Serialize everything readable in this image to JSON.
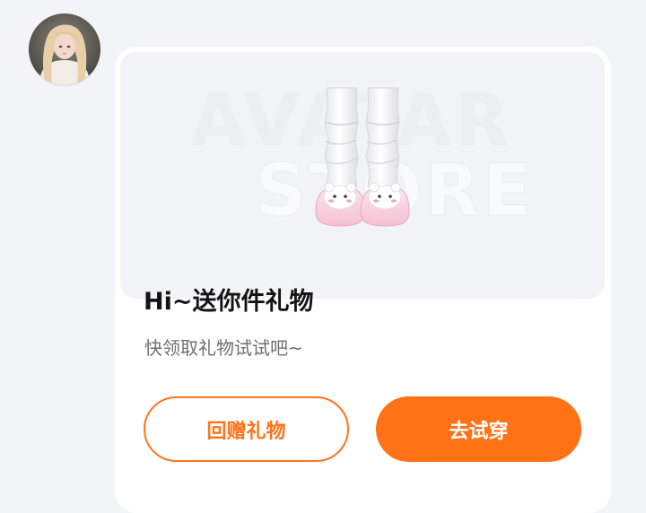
{
  "avatar": {
    "icon": "user-avatar-icon"
  },
  "gift_card": {
    "banner": {
      "watermark_top": "AVATAR",
      "watermark_bottom": "STORE",
      "item_icon": "sock-slippers-icon"
    },
    "title": "Hi~送你件礼物",
    "subtitle": "快领取礼物试试吧~",
    "buttons": {
      "return_gift": "回赠礼物",
      "try_on": "去试穿"
    }
  },
  "colors": {
    "accent": "#ff7215",
    "background": "#f3f4f8",
    "card": "#ffffff",
    "banner": "#f2f3f6"
  }
}
